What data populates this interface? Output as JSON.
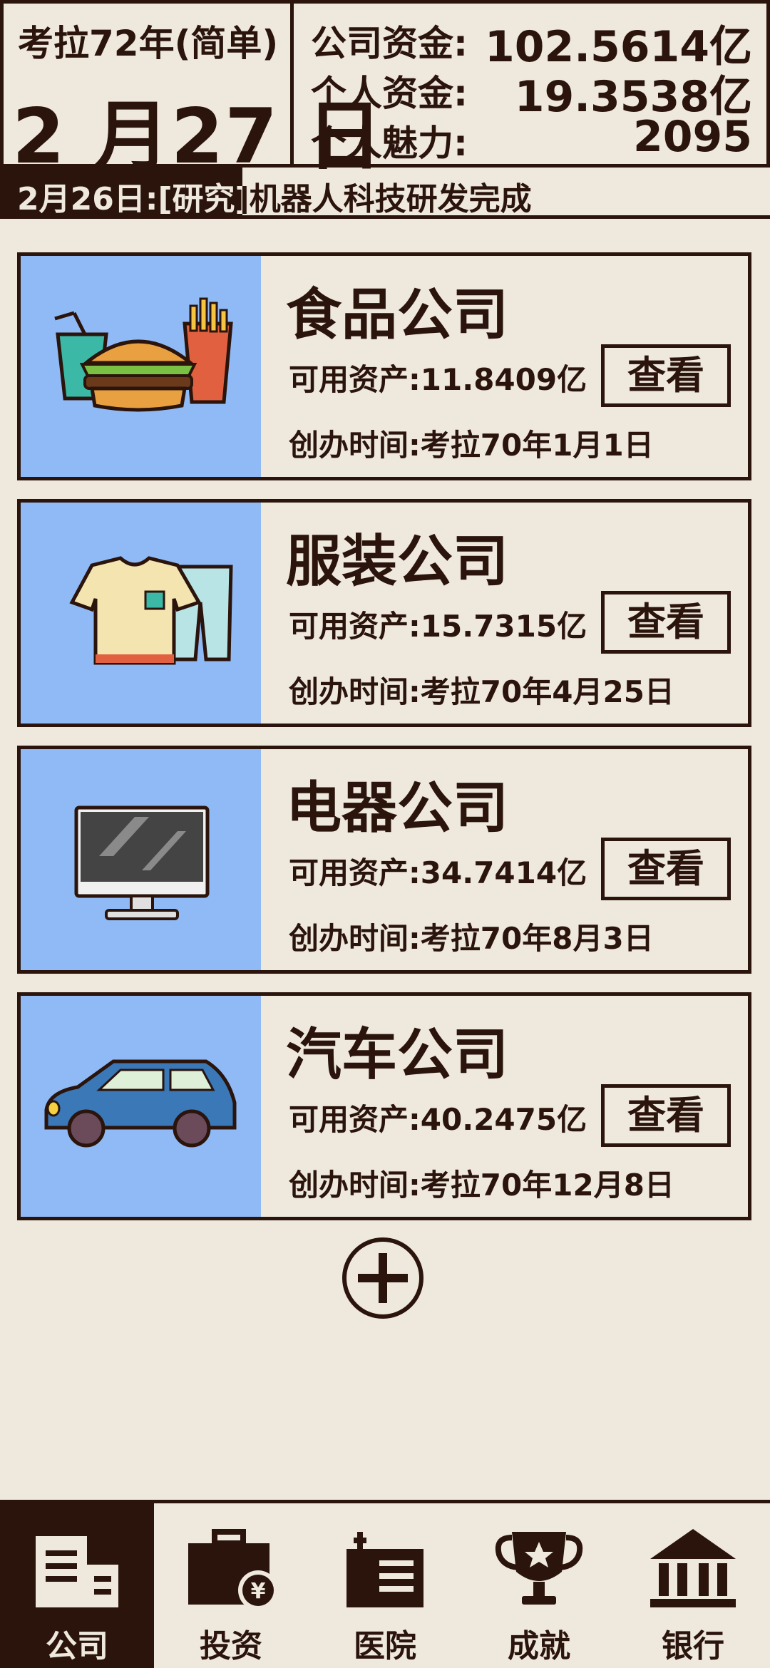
{
  "header": {
    "year_label": "考拉72年(简单)",
    "day_label": "2 月27 日",
    "stats": [
      {
        "label": "公司资金:",
        "value": "102.5614亿"
      },
      {
        "label": "个人资金:",
        "value": "19.3538亿"
      },
      {
        "label": "个人魅力:",
        "value": "2095"
      }
    ]
  },
  "news": {
    "text": "2月26日:[研究]机器人科技研发完成"
  },
  "companies": [
    {
      "name": "食品公司",
      "assets": "可用资产:11.8409亿",
      "founded": "创办时间:考拉70年1月1日",
      "view_label": "查看",
      "icon": "food-icon"
    },
    {
      "name": "服装公司",
      "assets": "可用资产:15.7315亿",
      "founded": "创办时间:考拉70年4月25日",
      "view_label": "查看",
      "icon": "clothing-icon"
    },
    {
      "name": "电器公司",
      "assets": "可用资产:34.7414亿",
      "founded": "创办时间:考拉70年8月3日",
      "view_label": "查看",
      "icon": "monitor-icon"
    },
    {
      "name": "汽车公司",
      "assets": "可用资产:40.2475亿",
      "founded": "创办时间:考拉70年12月8日",
      "view_label": "查看",
      "icon": "car-icon"
    }
  ],
  "add_button_icon": "plus-circle-icon",
  "nav": [
    {
      "label": "公司",
      "icon": "building-icon",
      "active": true
    },
    {
      "label": "投资",
      "icon": "briefcase-yen-icon",
      "active": false
    },
    {
      "label": "医院",
      "icon": "hospital-icon",
      "active": false
    },
    {
      "label": "成就",
      "icon": "trophy-icon",
      "active": false
    },
    {
      "label": "银行",
      "icon": "bank-icon",
      "active": false
    }
  ],
  "colors": {
    "dark": "#2a140c",
    "background": "#efe9dd",
    "card_image_bg": "#90baf5"
  }
}
